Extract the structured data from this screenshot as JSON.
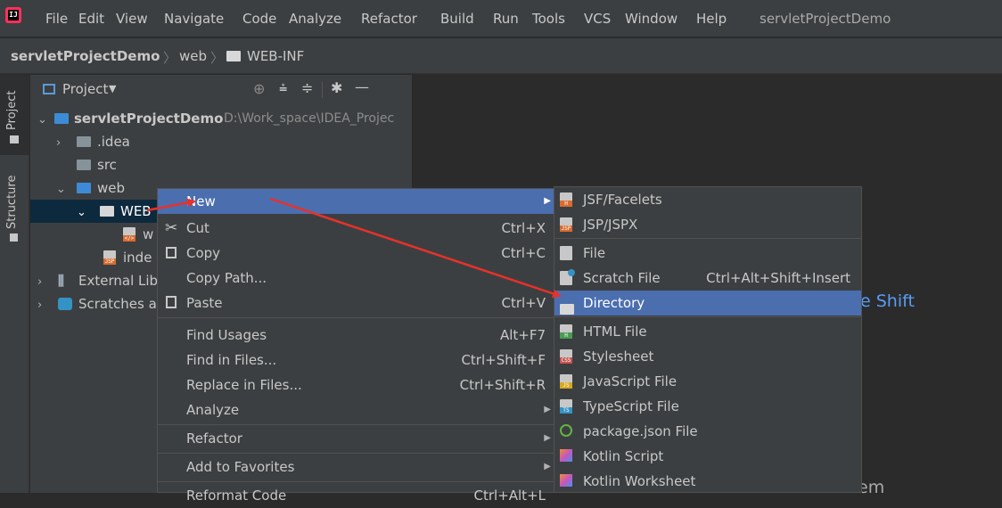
{
  "menubar": {
    "items": [
      "File",
      "Edit",
      "View",
      "Navigate",
      "Code",
      "Analyze",
      "Refactor",
      "Build",
      "Run",
      "Tools",
      "VCS",
      "Window",
      "Help"
    ],
    "project_title": "servletProjectDemo"
  },
  "breadcrumb": {
    "project": "servletProjectDemo",
    "web": "web",
    "webinf": "WEB-INF"
  },
  "left_strip": {
    "project_tab": "Project",
    "structure_tab": "Structure"
  },
  "project_panel": {
    "header": "Project",
    "tree": {
      "root": "servletProjectDemo",
      "root_path": "D:\\Work_space\\IDEA_Projec",
      "idea": ".idea",
      "src": "src",
      "web": "web",
      "webinf": "WEB",
      "webxml": "w",
      "index": "inde",
      "external": "External Lib",
      "scratches": "Scratches a"
    }
  },
  "editor": {
    "hint1": "e Shift",
    "hint2": "em"
  },
  "context_menu": {
    "new": "New",
    "cut": "Cut",
    "cut_short": "Ctrl+X",
    "copy": "Copy",
    "copy_short": "Ctrl+C",
    "copy_path": "Copy Path...",
    "paste": "Paste",
    "paste_short": "Ctrl+V",
    "find_usages": "Find Usages",
    "find_usages_short": "Alt+F7",
    "find_in_files": "Find in Files...",
    "find_in_files_short": "Ctrl+Shift+F",
    "replace_in_files": "Replace in Files...",
    "replace_in_files_short": "Ctrl+Shift+R",
    "analyze": "Analyze",
    "refactor": "Refactor",
    "add_to_favorites": "Add to Favorites",
    "reformat_code": "Reformat Code",
    "reformat_code_short": "Ctrl+Alt+L"
  },
  "submenu": {
    "jsf": "JSF/Facelets",
    "jsp": "JSP/JSPX",
    "file": "File",
    "scratch": "Scratch File",
    "scratch_short": "Ctrl+Alt+Shift+Insert",
    "directory": "Directory",
    "html": "HTML File",
    "stylesheet": "Stylesheet",
    "javascript": "JavaScript File",
    "typescript": "TypeScript File",
    "packagejson": "package.json File",
    "kotlin_script": "Kotlin Script",
    "kotlin_worksheet": "Kotlin Worksheet"
  },
  "colors": {
    "selection": "#4b6eaf",
    "annotation_arrow": "#e8312a",
    "menu_bg": "#3c3f41"
  }
}
